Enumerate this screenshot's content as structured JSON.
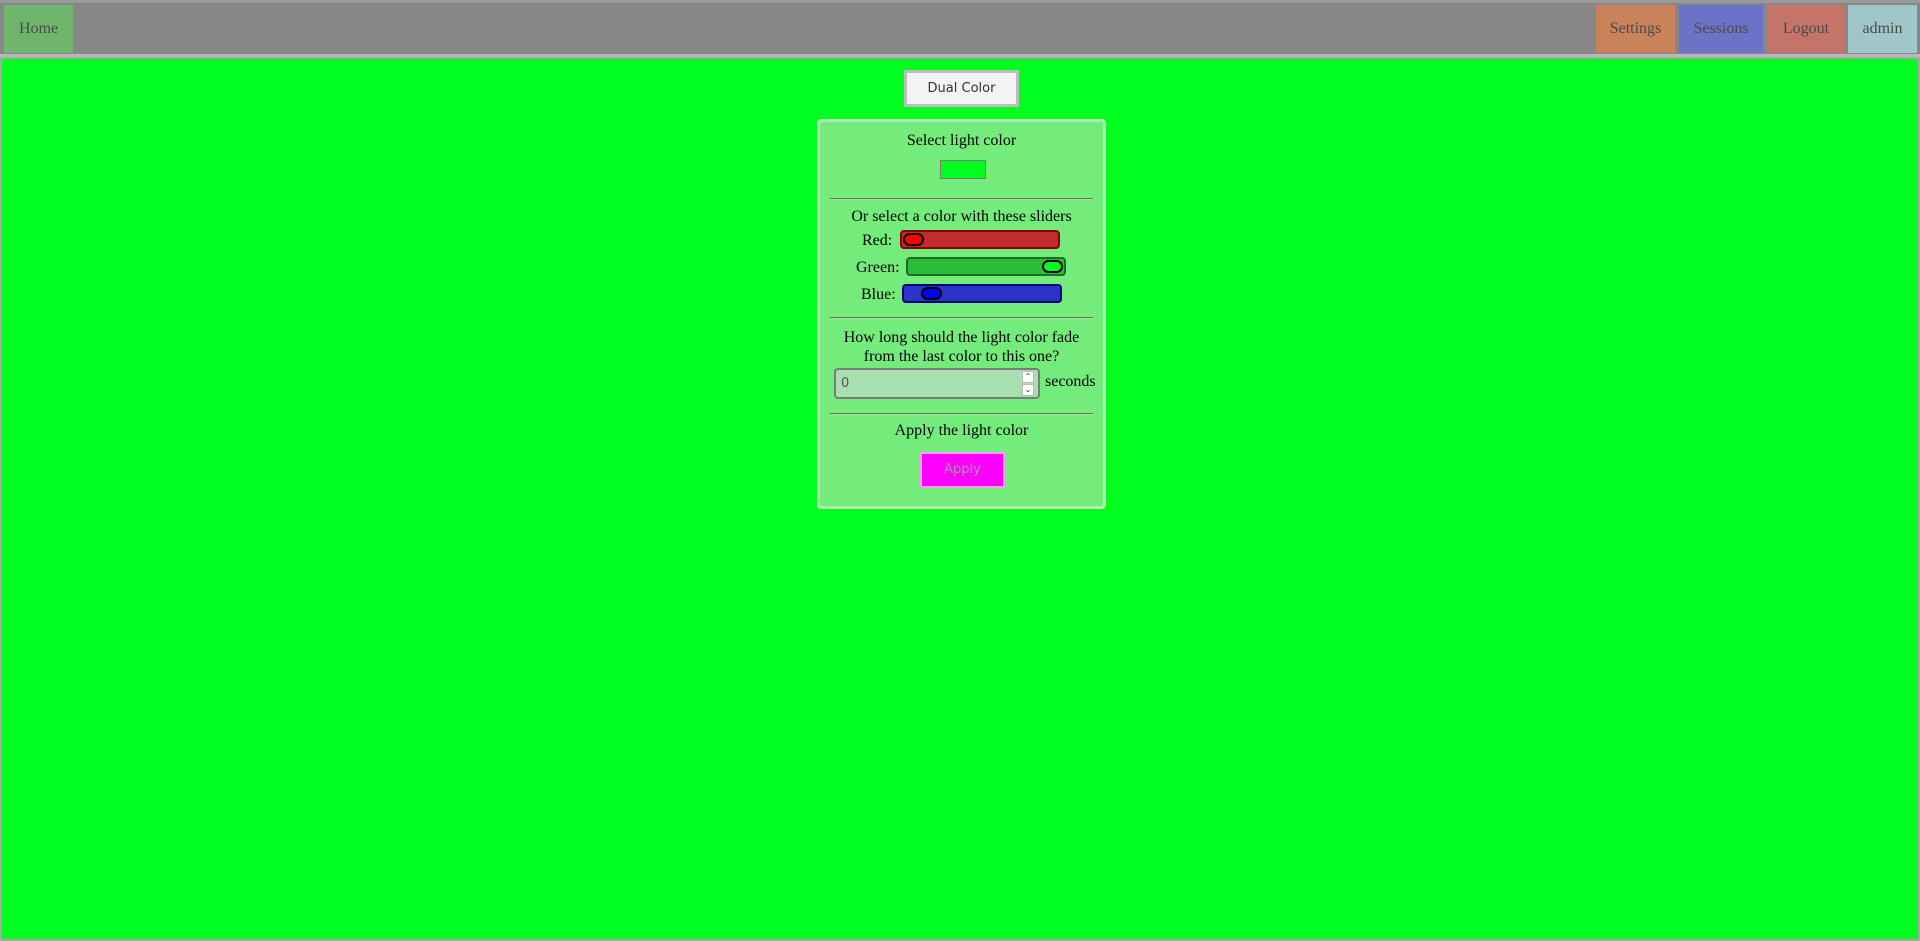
{
  "nav": {
    "home": "Home",
    "settings": "Settings",
    "sessions": "Sessions",
    "logout": "Logout",
    "user": "admin"
  },
  "mode_button": "Dual Color",
  "panel": {
    "select_title": "Select light color",
    "swatch_color": "#00ff1e",
    "sliders_title": "Or select a color with these sliders",
    "sliders": [
      {
        "label": "Red:",
        "value": 0,
        "max": 255,
        "track_color": "#c42b2b",
        "border_color": "#8a0000",
        "thumb_color": "#ff0000"
      },
      {
        "label": "Green:",
        "value": 255,
        "max": 255,
        "track_color": "#2dbb3a",
        "border_color": "#1b6e1b",
        "thumb_color": "#00ff1e"
      },
      {
        "label": "Blue:",
        "value": 30,
        "max": 255,
        "track_color": "#2b33c8",
        "border_color": "#00007a",
        "thumb_color": "#0000ff"
      }
    ],
    "fade_question": "How long should the light color fade from the last color to this one?",
    "fade_value": "0",
    "fade_unit": "seconds",
    "apply_title": "Apply the light color",
    "apply_button": "Apply"
  }
}
